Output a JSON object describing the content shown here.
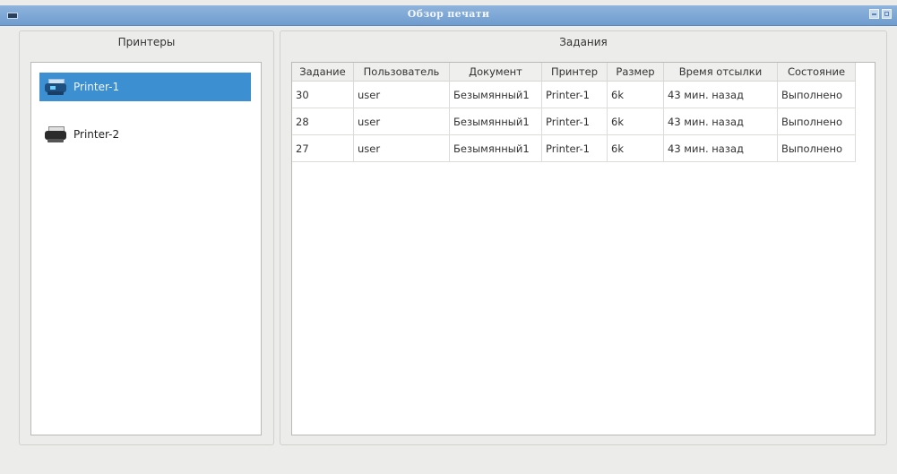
{
  "window": {
    "title": "Обзор печати"
  },
  "printers_panel": {
    "title": "Принтеры",
    "items": [
      {
        "label": "Printer-1",
        "selected": true
      },
      {
        "label": "Printer-2",
        "selected": false
      }
    ]
  },
  "jobs_panel": {
    "title": "Задания",
    "columns": [
      "Задание",
      "Пользователь",
      "Документ",
      "Принтер",
      "Размер",
      "Время отсылки",
      "Состояние"
    ],
    "rows": [
      [
        "30",
        "user",
        "Безымянный1",
        "Printer-1",
        "6k",
        "43 мин. назад",
        "Выполнено"
      ],
      [
        "28",
        "user",
        "Безымянный1",
        "Printer-1",
        "6k",
        "43 мин. назад",
        "Выполнено"
      ],
      [
        "27",
        "user",
        "Безымянный1",
        "Printer-1",
        "6k",
        "43 мин. назад",
        "Выполнено"
      ]
    ]
  },
  "colors": {
    "titlebar": "#7aa5d4",
    "selection": "#3c8fd0"
  },
  "icons": [
    "window-menu-icon",
    "minimize-icon",
    "maximize-icon",
    "printer-icon"
  ]
}
